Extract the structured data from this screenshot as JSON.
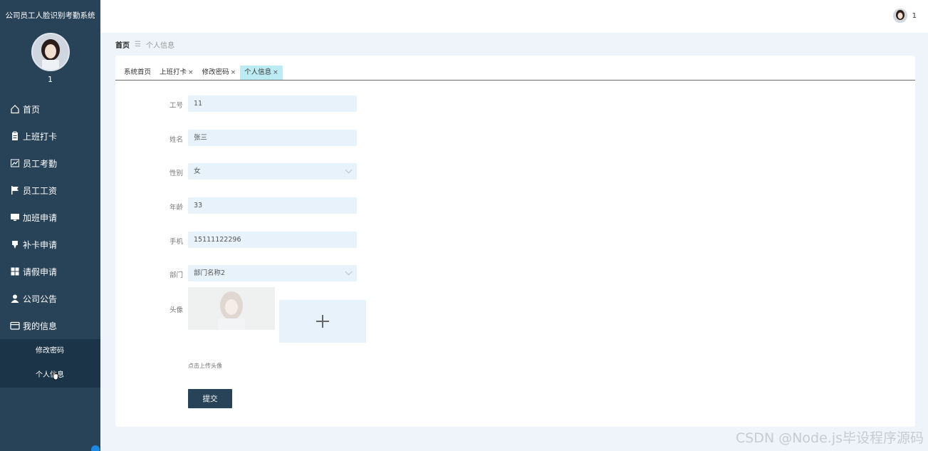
{
  "app": {
    "title": "公司员工人脸识别考勤系统",
    "username": "1"
  },
  "sidebar": {
    "items": [
      {
        "label": "首页",
        "icon": "home-icon"
      },
      {
        "label": "上班打卡",
        "icon": "clipboard-icon"
      },
      {
        "label": "员工考勤",
        "icon": "chart-icon"
      },
      {
        "label": "员工工资",
        "icon": "flag-icon"
      },
      {
        "label": "加班申请",
        "icon": "monitor-icon"
      },
      {
        "label": "补卡申请",
        "icon": "pin-icon"
      },
      {
        "label": "请假申请",
        "icon": "grid-icon"
      },
      {
        "label": "公司公告",
        "icon": "user-icon"
      },
      {
        "label": "我的信息",
        "icon": "wallet-icon"
      }
    ],
    "submenu": [
      {
        "label": "修改密码"
      },
      {
        "label": "个人信息"
      }
    ]
  },
  "header": {
    "username": "1"
  },
  "breadcrumb": {
    "home": "首页",
    "separator": "☰",
    "current": "个人信息"
  },
  "tabs": [
    {
      "label": "系统首页",
      "closable": false
    },
    {
      "label": "上班打卡",
      "closable": true
    },
    {
      "label": "修改密码",
      "closable": true
    },
    {
      "label": "个人信息",
      "closable": true,
      "active": true
    }
  ],
  "tab_close_glyph": "×",
  "form": {
    "employee_id": {
      "label": "工号",
      "value": "11"
    },
    "name": {
      "label": "姓名",
      "value": "张三"
    },
    "gender": {
      "label": "性别",
      "value": "女"
    },
    "age": {
      "label": "年龄",
      "value": "33"
    },
    "phone": {
      "label": "手机",
      "value": "15111122296"
    },
    "department": {
      "label": "部门",
      "value": "部门名称2"
    },
    "avatar": {
      "label": "头像",
      "hint": "点击上传头像"
    },
    "submit_label": "提交"
  },
  "watermark": "CSDN @Node.js毕设程序源码",
  "colors": {
    "sidebar": "#284257",
    "submenu": "#1c3447",
    "active_tab": "#bdebf3",
    "input_bg": "#e8f2fb",
    "page_bg": "#eef4fa"
  }
}
